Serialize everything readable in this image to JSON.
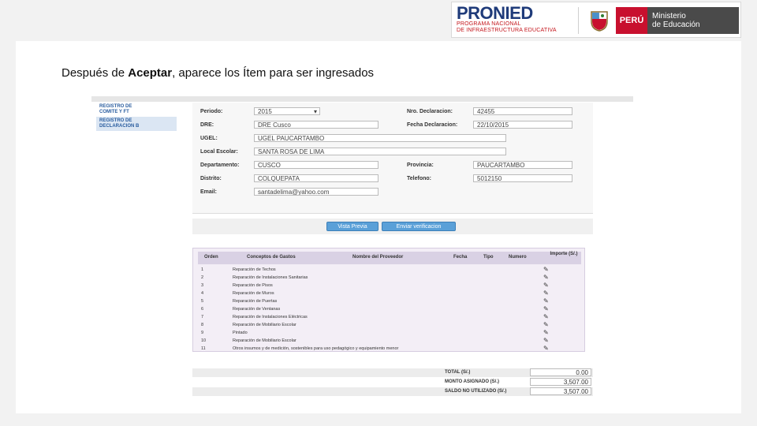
{
  "header": {
    "logo_name": "PRONIED",
    "logo_sub1": "PROGRAMA NACIONAL",
    "logo_sub2": "DE INFRAESTRUCTURA EDUCATIVA",
    "peru_label": "PERÚ",
    "ministry_line1": "Ministerio",
    "ministry_line2": "de Educación"
  },
  "caption": {
    "before": "Después de ",
    "bold": "Aceptar",
    "after": ", aparece los Ítem para ser ingresados"
  },
  "nav": {
    "items": [
      "REGISTRO DE",
      "COMITE Y FT",
      "REGISTRO DE",
      "DECLARACION B"
    ]
  },
  "form": {
    "periodo_label": "Periodo:",
    "periodo_value": "2015",
    "nro_label": "Nro. Declaracion:",
    "nro_value": "42455",
    "dre_label": "DRE:",
    "dre_value": "DRE Cusco",
    "fecha_label": "Fecha Declaracion:",
    "fecha_value": "22/10/2015",
    "ugel_label": "UGEL:",
    "ugel_value": "UGEL PAUCARTAMBO",
    "local_label": "Local Escolar:",
    "local_value": "SANTA ROSA DE LIMA",
    "dep_label": "Departamento:",
    "dep_value": "CUSCO",
    "prov_label": "Provincia:",
    "prov_value": "PAUCARTAMBO",
    "dist_label": "Distrito:",
    "dist_value": "COLQUEPATA",
    "tel_label": "Telefono:",
    "tel_value": "5012150",
    "email_label": "Email:",
    "email_value": "santadelima@yahoo.com"
  },
  "buttons": {
    "preview": "Vista Previa",
    "send": "Enviar verificacion"
  },
  "table": {
    "headers": [
      "Orden",
      "Conceptos de Gastos",
      "Nombre del Proveedor",
      "Fecha",
      "Tipo",
      "Numero",
      "Importe (S/.)"
    ],
    "rows": [
      [
        "1",
        "Reparación de Techos"
      ],
      [
        "2",
        "Reparación de Instalaciones Sanitarias"
      ],
      [
        "3",
        "Reparación de Pisos"
      ],
      [
        "4",
        "Reparación de Muros"
      ],
      [
        "5",
        "Reparación de Puertas"
      ],
      [
        "6",
        "Reparación de Ventanas"
      ],
      [
        "7",
        "Reparación de Instalaciones Eléctricas"
      ],
      [
        "8",
        "Reparación de Mobiliario Escolar"
      ],
      [
        "9",
        "Pintado"
      ],
      [
        "10",
        "Reparación de Mobiliario Escolar"
      ],
      [
        "11",
        "Otros insumos y de medición, sostenibles para uso pedagógico y equipamiento menor"
      ]
    ]
  },
  "totals": {
    "total_label": "TOTAL (S/.)",
    "total_value": "0.00",
    "monto_label": "MONTO ASIGNADO (S/.)",
    "monto_value": "3,507.00",
    "saldo_label": "SALDO NO UTILIZADO (S/.)",
    "saldo_value": "3,507.00"
  }
}
